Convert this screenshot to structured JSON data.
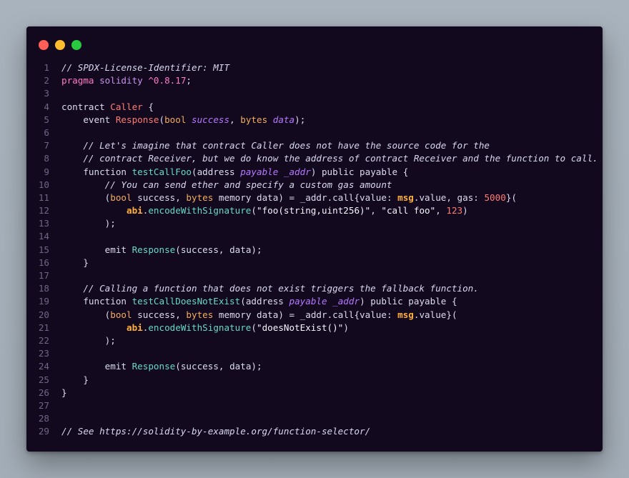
{
  "window": {
    "controls": [
      "close",
      "minimize",
      "maximize"
    ]
  },
  "code": {
    "lines": [
      [
        [
          "c",
          "// SPDX-License-Identifier: MIT"
        ]
      ],
      [
        [
          "kw",
          "pragma "
        ],
        [
          "p",
          "solidity "
        ],
        [
          "kw",
          "^0.8.17"
        ],
        [
          "k",
          ";"
        ]
      ],
      [],
      [
        [
          "k",
          "contract "
        ],
        [
          "cls",
          "Caller"
        ],
        [
          "k",
          " {"
        ]
      ],
      [
        [
          "k",
          "    event "
        ],
        [
          "cls",
          "Response"
        ],
        [
          "k",
          "("
        ],
        [
          "y",
          "bool "
        ],
        [
          "i",
          "success"
        ],
        [
          "k",
          ", "
        ],
        [
          "y",
          "bytes "
        ],
        [
          "i",
          "data"
        ],
        [
          "k",
          ");"
        ]
      ],
      [],
      [
        [
          "c",
          "    // Let's imagine that contract Caller does not have the source code for the"
        ]
      ],
      [
        [
          "c",
          "    // contract Receiver, but we do know the address of contract Receiver and the function to call."
        ]
      ],
      [
        [
          "k",
          "    function "
        ],
        [
          "f",
          "testCallFoo"
        ],
        [
          "k",
          "(address "
        ],
        [
          "i",
          "payable _addr"
        ],
        [
          "k",
          ") public payable {"
        ]
      ],
      [
        [
          "c",
          "        // You can send ether and specify a custom gas amount"
        ]
      ],
      [
        [
          "k",
          "        ("
        ],
        [
          "y",
          "bool"
        ],
        [
          "k",
          " success, "
        ],
        [
          "y",
          "bytes"
        ],
        [
          "k",
          " memory data) = _addr.call{value: "
        ],
        [
          "o",
          "msg"
        ],
        [
          "k",
          ".value, gas: "
        ],
        [
          "n",
          "5000"
        ],
        [
          "k",
          "}("
        ]
      ],
      [
        [
          "o",
          "            abi"
        ],
        [
          "k",
          "."
        ],
        [
          "f",
          "encodeWithSignature"
        ],
        [
          "k",
          "("
        ],
        [
          "s",
          "\"foo(string,uint256)\""
        ],
        [
          "k",
          ", "
        ],
        [
          "s",
          "\"call foo\""
        ],
        [
          "k",
          ", "
        ],
        [
          "n",
          "123"
        ],
        [
          "k",
          ")"
        ]
      ],
      [
        [
          "k",
          "        );"
        ]
      ],
      [],
      [
        [
          "k",
          "        emit "
        ],
        [
          "f",
          "Response"
        ],
        [
          "k",
          "(success, data);"
        ]
      ],
      [
        [
          "k",
          "    }"
        ]
      ],
      [],
      [
        [
          "c",
          "    // Calling a function that does not exist triggers the fallback function."
        ]
      ],
      [
        [
          "k",
          "    function "
        ],
        [
          "f",
          "testCallDoesNotExist"
        ],
        [
          "k",
          "(address "
        ],
        [
          "i",
          "payable _addr"
        ],
        [
          "k",
          ") public payable {"
        ]
      ],
      [
        [
          "k",
          "        ("
        ],
        [
          "y",
          "bool"
        ],
        [
          "k",
          " success, "
        ],
        [
          "y",
          "bytes"
        ],
        [
          "k",
          " memory data) = _addr.call{value: "
        ],
        [
          "o",
          "msg"
        ],
        [
          "k",
          ".value}("
        ]
      ],
      [
        [
          "o",
          "            abi"
        ],
        [
          "k",
          "."
        ],
        [
          "f",
          "encodeWithSignature"
        ],
        [
          "k",
          "("
        ],
        [
          "s",
          "\"doesNotExist()\""
        ],
        [
          "k",
          ")"
        ]
      ],
      [
        [
          "k",
          "        );"
        ]
      ],
      [],
      [
        [
          "k",
          "        emit "
        ],
        [
          "f",
          "Response"
        ],
        [
          "k",
          "(success, data);"
        ]
      ],
      [
        [
          "k",
          "    }"
        ]
      ],
      [
        [
          "k",
          "}"
        ]
      ],
      [],
      [],
      [
        [
          "c",
          "// See https://solidity-by-example.org/function-selector/"
        ]
      ]
    ]
  }
}
